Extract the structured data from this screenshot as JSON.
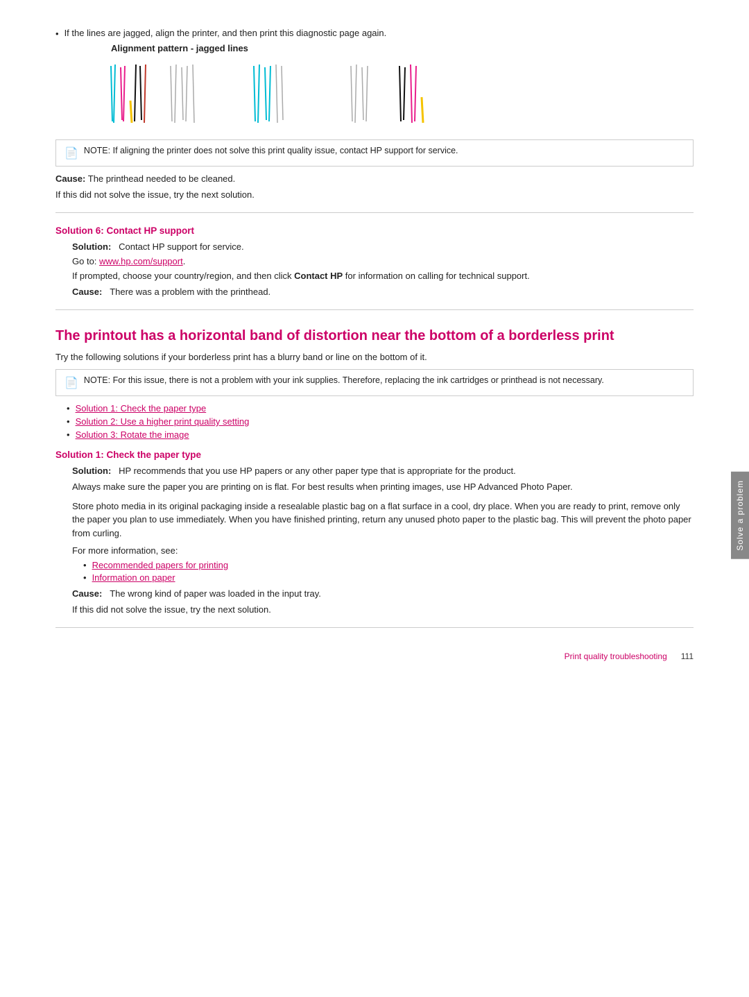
{
  "page": {
    "bullet_intro": "If the lines are jagged, align the printer, and then print this diagnostic page again.",
    "alignment_label": "Alignment pattern - jagged lines",
    "note1": "NOTE:  If aligning the printer does not solve this print quality issue, contact HP support for service.",
    "cause1_label": "Cause:",
    "cause1_text": "The printhead needed to be cleaned.",
    "if_not_solved": "If this did not solve the issue, try the next solution.",
    "sol6_heading": "Solution 6: Contact HP support",
    "sol6_solution_label": "Solution:",
    "sol6_solution_text": "Contact HP support for service.",
    "sol6_goto": "Go to: ",
    "sol6_link": "www.hp.com/support",
    "sol6_link_href": "www.hp.com/support",
    "sol6_if_prompted": "If prompted, choose your country/region, and then click ",
    "sol6_contact_hp_bold": "Contact HP",
    "sol6_contact_hp_rest": " for information on calling for technical support.",
    "sol6_cause_label": "Cause:",
    "sol6_cause_text": "There was a problem with the printhead.",
    "main_heading": "The printout has a horizontal band of distortion near the bottom of a borderless print",
    "main_intro": "Try the following solutions if your borderless print has a blurry band or line on the bottom of it.",
    "note2": "NOTE:   For this issue, there is not a problem with your ink supplies. Therefore, replacing the ink cartridges or printhead is not necessary.",
    "solution_links": [
      {
        "text": "Solution 1: Check the paper type",
        "href": "#sol1"
      },
      {
        "text": "Solution 2: Use a higher print quality setting",
        "href": "#sol2"
      },
      {
        "text": "Solution 3: Rotate the image",
        "href": "#sol3"
      }
    ],
    "sol1_heading": "Solution 1: Check the paper type",
    "sol1_solution_label": "Solution:",
    "sol1_solution_text": "HP recommends that you use HP papers or any other paper type that is appropriate for the product.",
    "sol1_para1": "Always make sure the paper you are printing on is flat. For best results when printing images, use HP Advanced Photo Paper.",
    "sol1_para2": "Store photo media in its original packaging inside a resealable plastic bag on a flat surface in a cool, dry place. When you are ready to print, remove only the paper you plan to use immediately. When you have finished printing, return any unused photo paper to the plastic bag. This will prevent the photo paper from curling.",
    "sol1_for_more": "For more information, see:",
    "sol1_links": [
      {
        "text": "Recommended papers for printing"
      },
      {
        "text": "Information on paper"
      }
    ],
    "sol1_cause_label": "Cause:",
    "sol1_cause_text": "The wrong kind of paper was loaded in the input tray.",
    "sol1_if_not_solved": "If this did not solve the issue, try the next solution.",
    "side_tab": "Solve a problem",
    "footer_label": "Print quality troubleshooting",
    "footer_page": "111"
  }
}
